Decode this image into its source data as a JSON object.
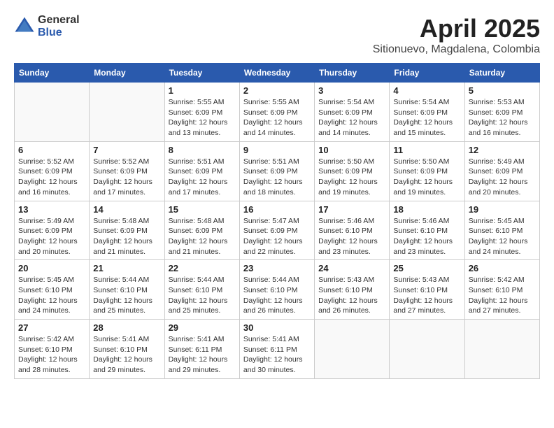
{
  "header": {
    "logo_general": "General",
    "logo_blue": "Blue",
    "month": "April 2025",
    "location": "Sitionuevo, Magdalena, Colombia"
  },
  "weekdays": [
    "Sunday",
    "Monday",
    "Tuesday",
    "Wednesday",
    "Thursday",
    "Friday",
    "Saturday"
  ],
  "weeks": [
    [
      {
        "day": "",
        "info": ""
      },
      {
        "day": "",
        "info": ""
      },
      {
        "day": "1",
        "info": "Sunrise: 5:55 AM\nSunset: 6:09 PM\nDaylight: 12 hours and 13 minutes."
      },
      {
        "day": "2",
        "info": "Sunrise: 5:55 AM\nSunset: 6:09 PM\nDaylight: 12 hours and 14 minutes."
      },
      {
        "day": "3",
        "info": "Sunrise: 5:54 AM\nSunset: 6:09 PM\nDaylight: 12 hours and 14 minutes."
      },
      {
        "day": "4",
        "info": "Sunrise: 5:54 AM\nSunset: 6:09 PM\nDaylight: 12 hours and 15 minutes."
      },
      {
        "day": "5",
        "info": "Sunrise: 5:53 AM\nSunset: 6:09 PM\nDaylight: 12 hours and 16 minutes."
      }
    ],
    [
      {
        "day": "6",
        "info": "Sunrise: 5:52 AM\nSunset: 6:09 PM\nDaylight: 12 hours and 16 minutes."
      },
      {
        "day": "7",
        "info": "Sunrise: 5:52 AM\nSunset: 6:09 PM\nDaylight: 12 hours and 17 minutes."
      },
      {
        "day": "8",
        "info": "Sunrise: 5:51 AM\nSunset: 6:09 PM\nDaylight: 12 hours and 17 minutes."
      },
      {
        "day": "9",
        "info": "Sunrise: 5:51 AM\nSunset: 6:09 PM\nDaylight: 12 hours and 18 minutes."
      },
      {
        "day": "10",
        "info": "Sunrise: 5:50 AM\nSunset: 6:09 PM\nDaylight: 12 hours and 19 minutes."
      },
      {
        "day": "11",
        "info": "Sunrise: 5:50 AM\nSunset: 6:09 PM\nDaylight: 12 hours and 19 minutes."
      },
      {
        "day": "12",
        "info": "Sunrise: 5:49 AM\nSunset: 6:09 PM\nDaylight: 12 hours and 20 minutes."
      }
    ],
    [
      {
        "day": "13",
        "info": "Sunrise: 5:49 AM\nSunset: 6:09 PM\nDaylight: 12 hours and 20 minutes."
      },
      {
        "day": "14",
        "info": "Sunrise: 5:48 AM\nSunset: 6:09 PM\nDaylight: 12 hours and 21 minutes."
      },
      {
        "day": "15",
        "info": "Sunrise: 5:48 AM\nSunset: 6:09 PM\nDaylight: 12 hours and 21 minutes."
      },
      {
        "day": "16",
        "info": "Sunrise: 5:47 AM\nSunset: 6:09 PM\nDaylight: 12 hours and 22 minutes."
      },
      {
        "day": "17",
        "info": "Sunrise: 5:46 AM\nSunset: 6:10 PM\nDaylight: 12 hours and 23 minutes."
      },
      {
        "day": "18",
        "info": "Sunrise: 5:46 AM\nSunset: 6:10 PM\nDaylight: 12 hours and 23 minutes."
      },
      {
        "day": "19",
        "info": "Sunrise: 5:45 AM\nSunset: 6:10 PM\nDaylight: 12 hours and 24 minutes."
      }
    ],
    [
      {
        "day": "20",
        "info": "Sunrise: 5:45 AM\nSunset: 6:10 PM\nDaylight: 12 hours and 24 minutes."
      },
      {
        "day": "21",
        "info": "Sunrise: 5:44 AM\nSunset: 6:10 PM\nDaylight: 12 hours and 25 minutes."
      },
      {
        "day": "22",
        "info": "Sunrise: 5:44 AM\nSunset: 6:10 PM\nDaylight: 12 hours and 25 minutes."
      },
      {
        "day": "23",
        "info": "Sunrise: 5:44 AM\nSunset: 6:10 PM\nDaylight: 12 hours and 26 minutes."
      },
      {
        "day": "24",
        "info": "Sunrise: 5:43 AM\nSunset: 6:10 PM\nDaylight: 12 hours and 26 minutes."
      },
      {
        "day": "25",
        "info": "Sunrise: 5:43 AM\nSunset: 6:10 PM\nDaylight: 12 hours and 27 minutes."
      },
      {
        "day": "26",
        "info": "Sunrise: 5:42 AM\nSunset: 6:10 PM\nDaylight: 12 hours and 27 minutes."
      }
    ],
    [
      {
        "day": "27",
        "info": "Sunrise: 5:42 AM\nSunset: 6:10 PM\nDaylight: 12 hours and 28 minutes."
      },
      {
        "day": "28",
        "info": "Sunrise: 5:41 AM\nSunset: 6:10 PM\nDaylight: 12 hours and 29 minutes."
      },
      {
        "day": "29",
        "info": "Sunrise: 5:41 AM\nSunset: 6:11 PM\nDaylight: 12 hours and 29 minutes."
      },
      {
        "day": "30",
        "info": "Sunrise: 5:41 AM\nSunset: 6:11 PM\nDaylight: 12 hours and 30 minutes."
      },
      {
        "day": "",
        "info": ""
      },
      {
        "day": "",
        "info": ""
      },
      {
        "day": "",
        "info": ""
      }
    ]
  ]
}
